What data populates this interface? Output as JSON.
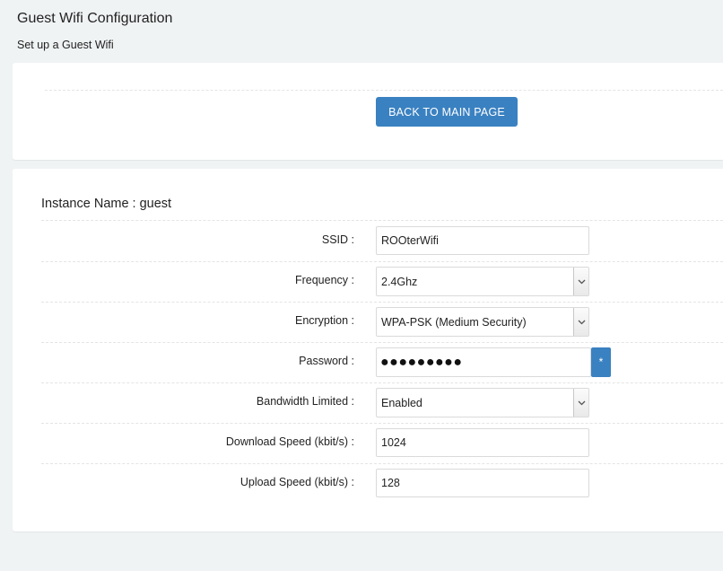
{
  "page": {
    "title": "Guest Wifi Configuration",
    "subtitle": "Set up a Guest Wifi"
  },
  "top_panel": {
    "back_button_label": "BACK TO MAIN PAGE"
  },
  "form": {
    "instance_label": "Instance Name : guest",
    "ssid": {
      "label": "SSID :",
      "value": "ROOterWifi"
    },
    "frequency": {
      "label": "Frequency :",
      "selected": "2.4Ghz"
    },
    "encryption": {
      "label": "Encryption :",
      "selected": "WPA-PSK (Medium Security)"
    },
    "password": {
      "label": "Password :",
      "masked_value": "●●●●●●●●●",
      "reveal_label": "*"
    },
    "bandwidth_limited": {
      "label": "Bandwidth Limited :",
      "selected": "Enabled"
    },
    "download_speed": {
      "label": "Download Speed (kbit/s) :",
      "value": "1024"
    },
    "upload_speed": {
      "label": "Upload Speed (kbit/s) :",
      "value": "128"
    }
  },
  "icons": {
    "select_arrow": "chevron-down-icon"
  },
  "colors": {
    "accent": "#3a81c1",
    "background": "#f0f3f4",
    "panel": "#ffffff"
  }
}
